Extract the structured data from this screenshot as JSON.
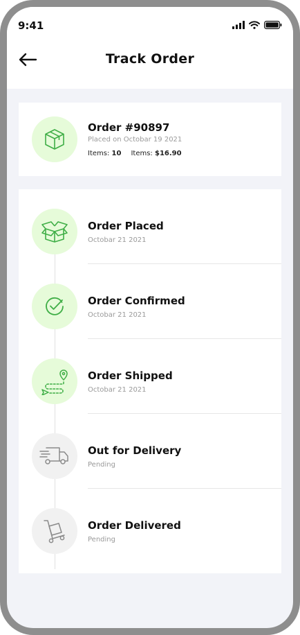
{
  "status_bar": {
    "time": "9:41"
  },
  "header": {
    "title": "Track Order"
  },
  "order": {
    "id_text": "Order #90897",
    "placed_text": "Placed on Octobar 19 2021",
    "items_label": "Items:",
    "items_value": "10",
    "total_label": "Items:",
    "total_value": "$16.90"
  },
  "steps": [
    {
      "title": "Order Placed",
      "subtitle": "Octobar 21 2021",
      "done": true,
      "icon": "open-box-icon"
    },
    {
      "title": "Order Confirmed",
      "subtitle": "Octobar 21 2021",
      "done": true,
      "icon": "check-circle-icon"
    },
    {
      "title": "Order Shipped",
      "subtitle": "Octobar 21 2021",
      "done": true,
      "icon": "route-pin-icon"
    },
    {
      "title": "Out for Delivery",
      "subtitle": "Pending",
      "done": false,
      "icon": "delivery-truck-icon"
    },
    {
      "title": "Order Delivered",
      "subtitle": "Pending",
      "done": false,
      "icon": "hand-truck-icon"
    }
  ],
  "colors": {
    "accent": "#4caf50",
    "accent_bg": "#e6fbd9",
    "pending": "#8a8a8a",
    "pending_bg": "#f1f1f1"
  }
}
